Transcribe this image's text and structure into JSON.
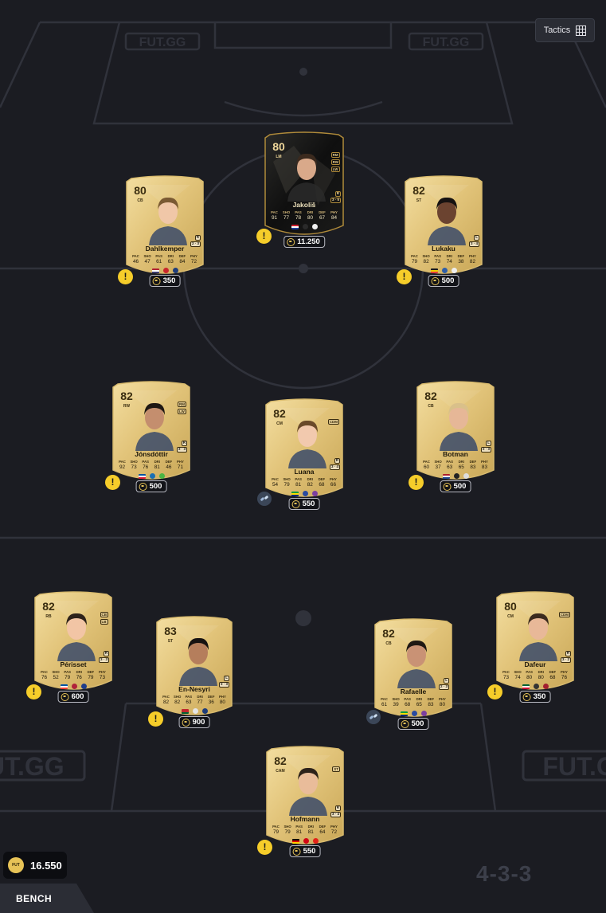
{
  "watermark": "FUT.GG",
  "tactics_label": "Tactics",
  "total_coins": "16.550",
  "bench_label": "BENCH",
  "formation": "4-3-3",
  "stat_labels": [
    "PAC",
    "SHO",
    "PAS",
    "DRI",
    "DEF",
    "PHY"
  ],
  "players": [
    {
      "id": "jakolis",
      "rating": "80",
      "position": "LM",
      "alt_positions": [
        "RM",
        "RW",
        "LW"
      ],
      "name": "Jakoliš",
      "stats": [
        "91",
        "77",
        "78",
        "80",
        "67",
        "84"
      ],
      "foot": "R",
      "skill_weak": "3 · 5",
      "price": "11.250",
      "slot": "ST",
      "special": "tots",
      "flags": [
        "#cf2030|#ffffff|#1e3f9a"
      ],
      "warning": true
    },
    {
      "id": "dahlkemper",
      "rating": "80",
      "position": "CB",
      "alt_positions": [],
      "name": "Dahlkemper",
      "stats": [
        "46",
        "47",
        "61",
        "63",
        "84",
        "72"
      ],
      "foot": "R",
      "skill_weak": "2 · 3",
      "price": "350",
      "slot": "LW",
      "warning": true
    },
    {
      "id": "lukaku",
      "rating": "82",
      "position": "ST",
      "alt_positions": [],
      "name": "Lukaku",
      "stats": [
        "79",
        "82",
        "73",
        "74",
        "38",
        "82"
      ],
      "foot": "L",
      "skill_weak": "3 · 4",
      "price": "500",
      "slot": "RW",
      "warning": true
    },
    {
      "id": "jonsdottir",
      "rating": "82",
      "position": "RW",
      "alt_positions": [
        "RM",
        "LW"
      ],
      "name": "Jónsdóttir",
      "stats": [
        "92",
        "73",
        "76",
        "81",
        "46",
        "71"
      ],
      "foot": "R",
      "skill_weak": "3 · 3",
      "price": "500",
      "slot": "CM",
      "warning": true
    },
    {
      "id": "luana",
      "rating": "82",
      "position": "CM",
      "alt_positions": [
        "CDM"
      ],
      "name": "Luana",
      "stats": [
        "54",
        "79",
        "81",
        "82",
        "68",
        "66"
      ],
      "foot": "R",
      "skill_weak": "3 · 4",
      "price": "550",
      "slot": "CM",
      "slot_plus": "+",
      "chem_link": true
    },
    {
      "id": "botman",
      "rating": "82",
      "position": "CB",
      "alt_positions": [],
      "name": "Botman",
      "stats": [
        "60",
        "37",
        "63",
        "65",
        "83",
        "83"
      ],
      "foot": "L",
      "skill_weak": "2 · 3",
      "price": "500",
      "slot": "CM",
      "warning": true
    },
    {
      "id": "perisset",
      "rating": "82",
      "position": "RB",
      "alt_positions": [
        "CB",
        "LB"
      ],
      "name": "Périsset",
      "stats": [
        "76",
        "52",
        "79",
        "76",
        "79",
        "73"
      ],
      "foot": "R",
      "skill_weak": "3 · 3",
      "price": "600",
      "slot": "LB",
      "warning": true
    },
    {
      "id": "en-nesyri",
      "rating": "83",
      "position": "ST",
      "alt_positions": [],
      "name": "En-Nesyri",
      "stats": [
        "82",
        "82",
        "63",
        "77",
        "36",
        "80"
      ],
      "foot": "L",
      "skill_weak": "3 · 3",
      "price": "900",
      "slot": "CB",
      "warning": true
    },
    {
      "id": "rafaelle",
      "rating": "82",
      "position": "CB",
      "alt_positions": [],
      "name": "Rafaelle",
      "stats": [
        "61",
        "39",
        "68",
        "65",
        "83",
        "80"
      ],
      "foot": "L",
      "skill_weak": "2 · 3",
      "price": "500",
      "slot": "CB",
      "slot_plus": "+",
      "chem_link": true
    },
    {
      "id": "dafeur",
      "rating": "80",
      "position": "CM",
      "alt_positions": [
        "CDM"
      ],
      "name": "Dafeur",
      "stats": [
        "73",
        "74",
        "80",
        "80",
        "68",
        "76"
      ],
      "foot": "R",
      "skill_weak": "3 · 2",
      "price": "350",
      "slot": "RB",
      "warning": true
    },
    {
      "id": "hofmann",
      "rating": "82",
      "position": "CAM",
      "alt_positions": [
        "ST"
      ],
      "name": "Hofmann",
      "stats": [
        "79",
        "79",
        "81",
        "81",
        "64",
        "72"
      ],
      "foot": "R",
      "skill_weak": "3 · 4",
      "price": "550",
      "slot": "GK",
      "warning": true
    }
  ],
  "colors": {
    "background": "#1b1c22",
    "lines": "#30323b",
    "card_gold": "#e8cd83",
    "warning": "#f6cd2a",
    "accent_plus": "#2fd27a"
  }
}
